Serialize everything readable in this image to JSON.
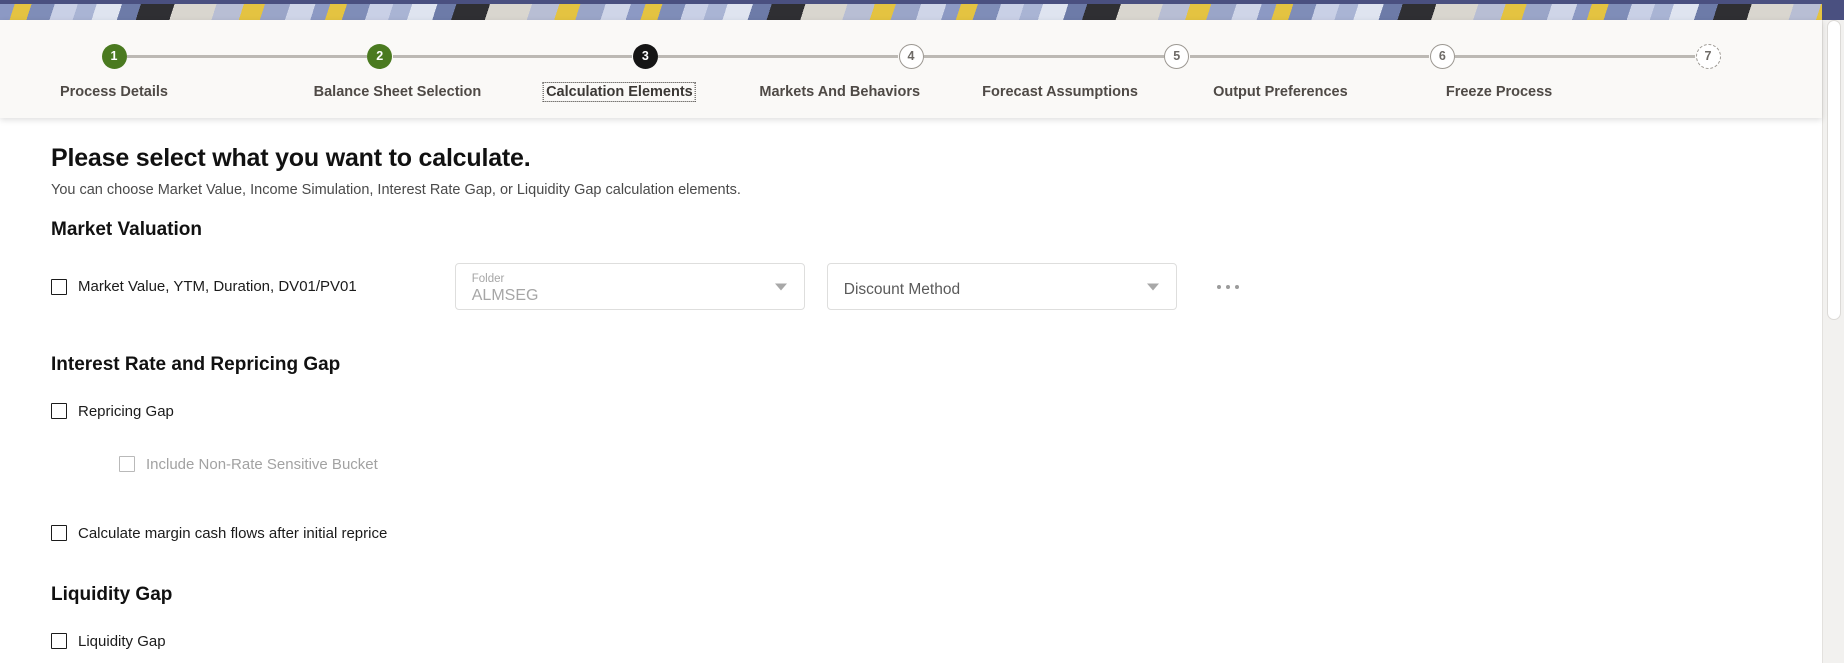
{
  "banner": {
    "name": "decorative-banner"
  },
  "stepper": {
    "steps": [
      {
        "number": "1",
        "label": "Process Details",
        "state": "done"
      },
      {
        "number": "2",
        "label": "Balance Sheet Selection",
        "state": "done"
      },
      {
        "number": "3",
        "label": "Calculation Elements",
        "state": "current"
      },
      {
        "number": "4",
        "label": "Markets And Behaviors",
        "state": "todo"
      },
      {
        "number": "5",
        "label": "Forecast Assumptions",
        "state": "todo"
      },
      {
        "number": "6",
        "label": "Output Preferences",
        "state": "todo"
      },
      {
        "number": "7",
        "label": "Freeze Process",
        "state": "future"
      }
    ],
    "colors": {
      "done": "#4a7a20",
      "current": "#151515",
      "todo_border": "#9c9892",
      "connector": "#bcb9b4"
    }
  },
  "main": {
    "title": "Please select what you want to calculate.",
    "subtitle": "You can choose Market Value, Income Simulation, Interest Rate Gap, or Liquidity Gap calculation elements.",
    "sections": [
      {
        "title": "Market Valuation",
        "checkbox_label": "Market Value, YTM, Duration, DV01/PV01",
        "checked": false,
        "folder_select": {
          "floating_label": "Folder",
          "value": "ALMSEG"
        },
        "discount_select": {
          "placeholder": "Discount Method"
        },
        "overflow_menu": "more-options"
      },
      {
        "title": "Interest Rate and Repricing Gap",
        "repricing_gap_label": "Repricing Gap",
        "repricing_gap_checked": false,
        "non_rate_bucket_label": "Include Non-Rate Sensitive Bucket",
        "non_rate_bucket_checked": false,
        "non_rate_bucket_disabled": true,
        "margin_cash_flows_label": "Calculate margin cash flows after initial reprice",
        "margin_cash_flows_checked": false
      },
      {
        "title": "Liquidity Gap",
        "checkbox_label": "Liquidity Gap",
        "checked": false
      }
    ]
  }
}
